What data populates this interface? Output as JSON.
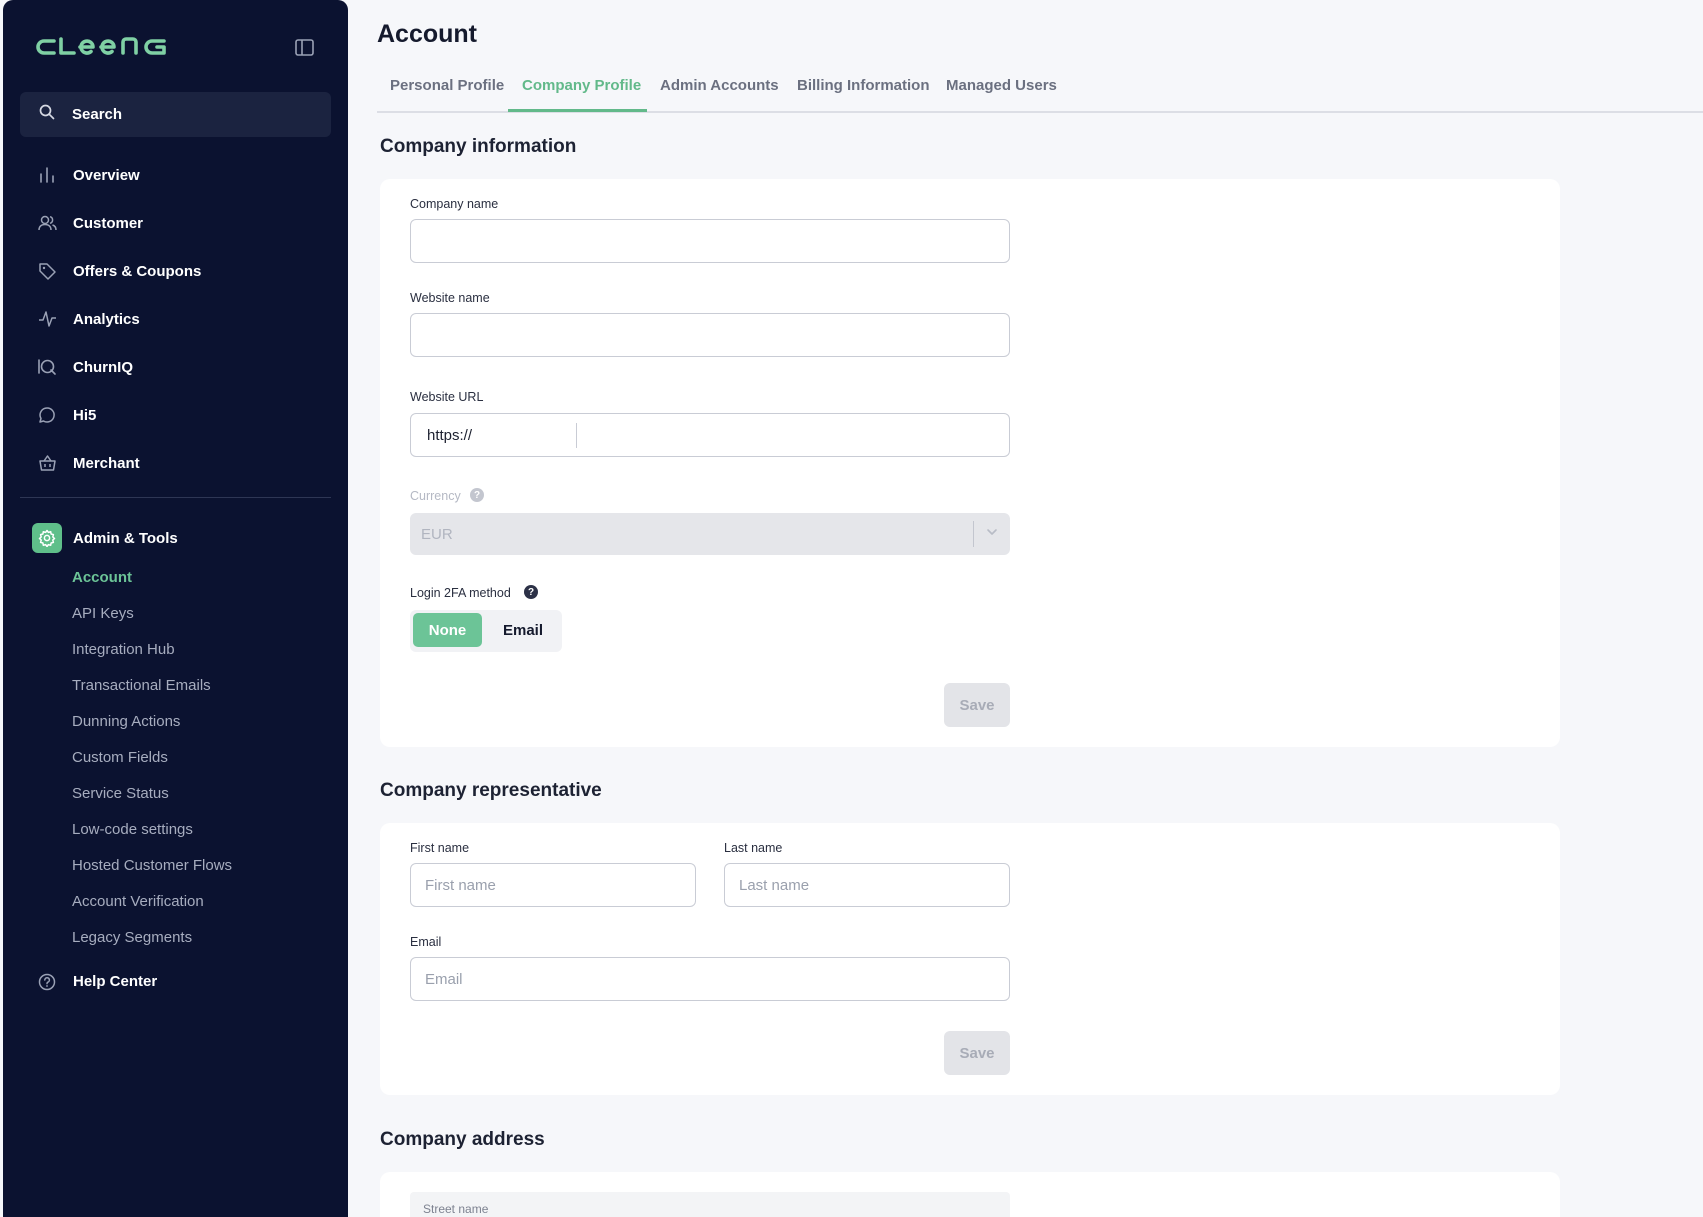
{
  "app": {
    "brand": "CLEENG"
  },
  "sidebar": {
    "search_label": "Search",
    "items": [
      {
        "label": "Overview",
        "icon": "bar-chart-icon"
      },
      {
        "label": "Customer",
        "icon": "users-icon"
      },
      {
        "label": "Offers & Coupons",
        "icon": "tag-icon"
      },
      {
        "label": "Analytics",
        "icon": "activity-icon"
      },
      {
        "label": "ChurnIQ",
        "icon": "churniq-icon"
      },
      {
        "label": "Hi5",
        "icon": "chat-bubble-icon"
      },
      {
        "label": "Merchant",
        "icon": "basket-icon"
      }
    ],
    "admin": {
      "label": "Admin & Tools",
      "icon": "gear-icon",
      "subitems": [
        {
          "label": "Account",
          "active": true
        },
        {
          "label": "API Keys"
        },
        {
          "label": "Integration Hub"
        },
        {
          "label": "Transactional Emails"
        },
        {
          "label": "Dunning Actions"
        },
        {
          "label": "Custom Fields"
        },
        {
          "label": "Service Status"
        },
        {
          "label": "Low-code settings"
        },
        {
          "label": "Hosted Customer Flows"
        },
        {
          "label": "Account Verification"
        },
        {
          "label": "Legacy Segments"
        }
      ]
    },
    "help_label": "Help Center"
  },
  "main": {
    "title": "Account",
    "tabs": [
      {
        "label": "Personal Profile"
      },
      {
        "label": "Company Profile",
        "active": true
      },
      {
        "label": "Admin Accounts"
      },
      {
        "label": "Billing Information"
      },
      {
        "label": "Managed Users"
      }
    ],
    "company_info": {
      "title": "Company information",
      "company_name_label": "Company name",
      "company_name_value": "",
      "website_name_label": "Website name",
      "website_name_value": "",
      "website_url_label": "Website URL",
      "website_url_prefix": "https://",
      "currency_label": "Currency",
      "currency_value": "EUR",
      "login_2fa_label": "Login 2FA method",
      "login_2fa_options": [
        "None",
        "Email"
      ],
      "login_2fa_selected": "None",
      "save_label": "Save"
    },
    "company_rep": {
      "title": "Company representative",
      "first_name_label": "First name",
      "first_name_placeholder": "First name",
      "last_name_label": "Last name",
      "last_name_placeholder": "Last name",
      "email_label": "Email",
      "email_placeholder": "Email",
      "save_label": "Save"
    },
    "company_address": {
      "title": "Company address",
      "street_label": "Street name"
    }
  },
  "colors": {
    "sidebar_bg": "#0b1230",
    "accent": "#62b98a",
    "page_bg": "#f6f7fa"
  }
}
